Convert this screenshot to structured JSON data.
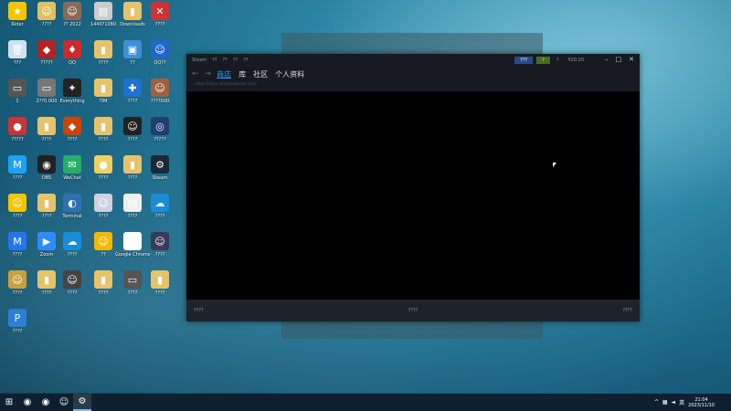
{
  "desktop_icons": [
    {
      "label": "Rider",
      "color": "#f5c400",
      "glyph": "★"
    },
    {
      "label": "????",
      "color": "#e0c060",
      "glyph": "☺"
    },
    {
      "label": "?? 2022",
      "color": "#8a6a5a",
      "glyph": "☺"
    },
    {
      "label": "1440?1080",
      "color": "#cccccc",
      "glyph": "▤"
    },
    {
      "label": "Downloads",
      "color": "#e6c36a",
      "glyph": "▮"
    },
    {
      "label": "????",
      "color": "#cc3333",
      "glyph": "✕"
    },
    {
      "label": "???",
      "color": "#cfe0f0",
      "glyph": "🗑"
    },
    {
      "label": "?????",
      "color": "#b22222",
      "glyph": "◆"
    },
    {
      "label": "QQ",
      "color": "#cc2b2b",
      "glyph": "♦"
    },
    {
      "label": "????",
      "color": "#e6c36a",
      "glyph": "▮"
    },
    {
      "label": "??",
      "color": "#3f8fd6",
      "glyph": "▣"
    },
    {
      "label": "QQ??",
      "color": "#2266cc",
      "glyph": "☺"
    },
    {
      "label": "1",
      "color": "#555555",
      "glyph": "▭"
    },
    {
      "label": "2??0.000",
      "color": "#777777",
      "glyph": "▭"
    },
    {
      "label": "Everything",
      "color": "#222222",
      "glyph": "✦"
    },
    {
      "label": "TIM",
      "color": "#e6c36a",
      "glyph": "▮"
    },
    {
      "label": "????",
      "color": "#2070d0",
      "glyph": "✚"
    },
    {
      "label": "????000",
      "color": "#a06040",
      "glyph": "☺"
    },
    {
      "label": "?????",
      "color": "#cc3333",
      "glyph": "●"
    },
    {
      "label": "????",
      "color": "#e6c36a",
      "glyph": "▮"
    },
    {
      "label": "????",
      "color": "#cc4400",
      "glyph": "◆"
    },
    {
      "label": "????",
      "color": "#e6c36a",
      "glyph": "▮"
    },
    {
      "label": "????",
      "color": "#222222",
      "glyph": "☺"
    },
    {
      "label": "?????",
      "color": "#1f3f6f",
      "glyph": "◎"
    },
    {
      "label": "????",
      "color": "#1da1f2",
      "glyph": "M"
    },
    {
      "label": "OBS",
      "color": "#222222",
      "glyph": "◉"
    },
    {
      "label": "WeChat",
      "color": "#2aae67",
      "glyph": "✉"
    },
    {
      "label": "????",
      "color": "#f0d060",
      "glyph": "●"
    },
    {
      "label": "????",
      "color": "#e6c36a",
      "glyph": "▮"
    },
    {
      "label": "Steam",
      "color": "#1b2838",
      "glyph": "⚙"
    },
    {
      "label": "????",
      "color": "#f5c400",
      "glyph": "☺"
    },
    {
      "label": "????",
      "color": "#e6c36a",
      "glyph": "▮"
    },
    {
      "label": "Terminal",
      "color": "#3070b0",
      "glyph": "◐"
    },
    {
      "label": "????",
      "color": "#d0d0e0",
      "glyph": "☺"
    },
    {
      "label": "????",
      "color": "#eeeeee",
      "glyph": "▤"
    },
    {
      "label": "????",
      "color": "#1a8cd8",
      "glyph": "☁"
    },
    {
      "label": "????",
      "color": "#2277ee",
      "glyph": "M"
    },
    {
      "label": "Zoom",
      "color": "#2d8cff",
      "glyph": "▶"
    },
    {
      "label": "????",
      "color": "#1a8cd8",
      "glyph": "☁"
    },
    {
      "label": "??",
      "color": "#f5b800",
      "glyph": "☺"
    },
    {
      "label": "Google Chrome",
      "color": "#ffffff",
      "glyph": "◉"
    },
    {
      "label": "????",
      "color": "#3a3a5a",
      "glyph": "☺"
    },
    {
      "label": "????",
      "color": "#c8a040",
      "glyph": "☺"
    },
    {
      "label": "????",
      "color": "#e6c36a",
      "glyph": "▮"
    },
    {
      "label": "????",
      "color": "#444444",
      "glyph": "☺"
    },
    {
      "label": "????",
      "color": "#e6c36a",
      "glyph": "▮"
    },
    {
      "label": "????",
      "color": "#555555",
      "glyph": "▭"
    },
    {
      "label": "????",
      "color": "#e6c36a",
      "glyph": "▮"
    },
    {
      "label": "????",
      "color": "#2c7fd6",
      "glyph": "P"
    }
  ],
  "steam": {
    "title_menu": [
      "Steam",
      "??",
      "??",
      "??",
      "??"
    ],
    "nav": {
      "store": "商店",
      "library": "库",
      "community": "社区",
      "profile": "个人资料"
    },
    "url": "https://store.steampowered.com/",
    "buttons": {
      "btn1": "???",
      "btn2": "?",
      "help": "?",
      "wallet": "¥20.20"
    },
    "footer": {
      "left": "????",
      "middle": "????",
      "right": "????"
    }
  },
  "taskbar": {
    "items": [
      {
        "name": "start-button",
        "glyph": "⊞"
      },
      {
        "name": "app-1",
        "glyph": "◉"
      },
      {
        "name": "chrome",
        "glyph": "◉"
      },
      {
        "name": "app-3",
        "glyph": "☺"
      },
      {
        "name": "steam",
        "glyph": "⚙"
      }
    ],
    "time": "21:04",
    "date": "2023/11/10",
    "lang": "英"
  }
}
